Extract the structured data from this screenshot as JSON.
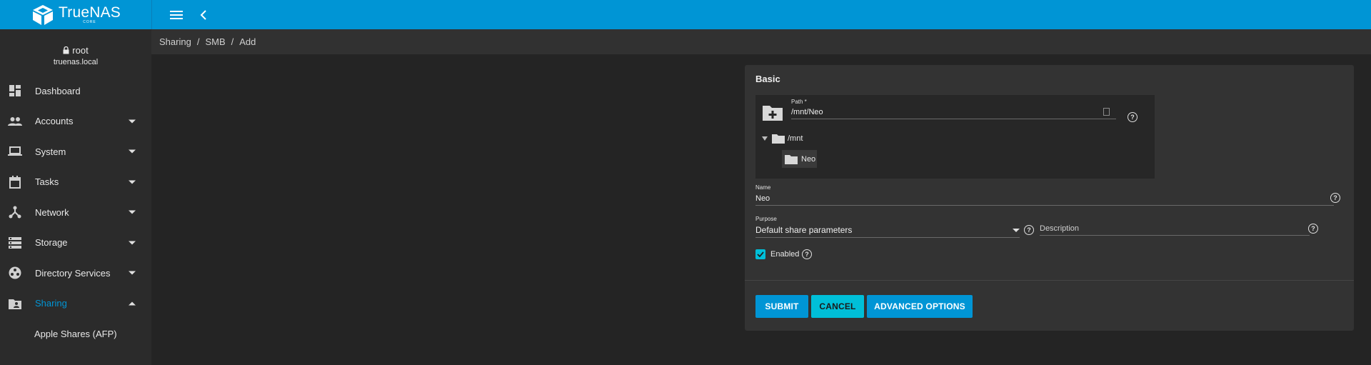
{
  "app": {
    "brand_name": "TrueNAS",
    "brand_sub": "CORE",
    "brand_color": "#0095d5"
  },
  "user": {
    "username": "root",
    "hostname": "truenas.local"
  },
  "sidebar": {
    "items": [
      {
        "label": "Dashboard",
        "icon": "dashboard-icon"
      },
      {
        "label": "Accounts",
        "icon": "people-icon"
      },
      {
        "label": "System",
        "icon": "laptop-icon"
      },
      {
        "label": "Tasks",
        "icon": "calendar-icon"
      },
      {
        "label": "Network",
        "icon": "network-icon"
      },
      {
        "label": "Storage",
        "icon": "storage-icon"
      },
      {
        "label": "Directory Services",
        "icon": "directory-icon"
      },
      {
        "label": "Sharing",
        "icon": "folder-shared-icon",
        "active": true
      }
    ],
    "subitems": [
      {
        "label": "Apple Shares (AFP)"
      }
    ]
  },
  "breadcrumb": [
    "Sharing",
    "SMB",
    "Add"
  ],
  "form": {
    "title": "Basic",
    "path": {
      "label": "Path *",
      "value": "/mnt/Neo",
      "tree_root": "/mnt",
      "tree_child": "Neo"
    },
    "name": {
      "label": "Name",
      "value": "Neo"
    },
    "purpose": {
      "label": "Purpose",
      "value": "Default share parameters"
    },
    "description": {
      "placeholder": "Description"
    },
    "enabled": {
      "label": "Enabled",
      "checked": true
    },
    "buttons": {
      "submit": "SUBMIT",
      "cancel": "CANCEL",
      "advanced": "ADVANCED OPTIONS"
    },
    "help_glyph": "?"
  },
  "colors": {
    "accent": "#0095d5",
    "secondary": "#00bfd8",
    "sidebar_bg": "#2b2b2b",
    "content_bg": "#242424",
    "card_bg": "#333333"
  }
}
